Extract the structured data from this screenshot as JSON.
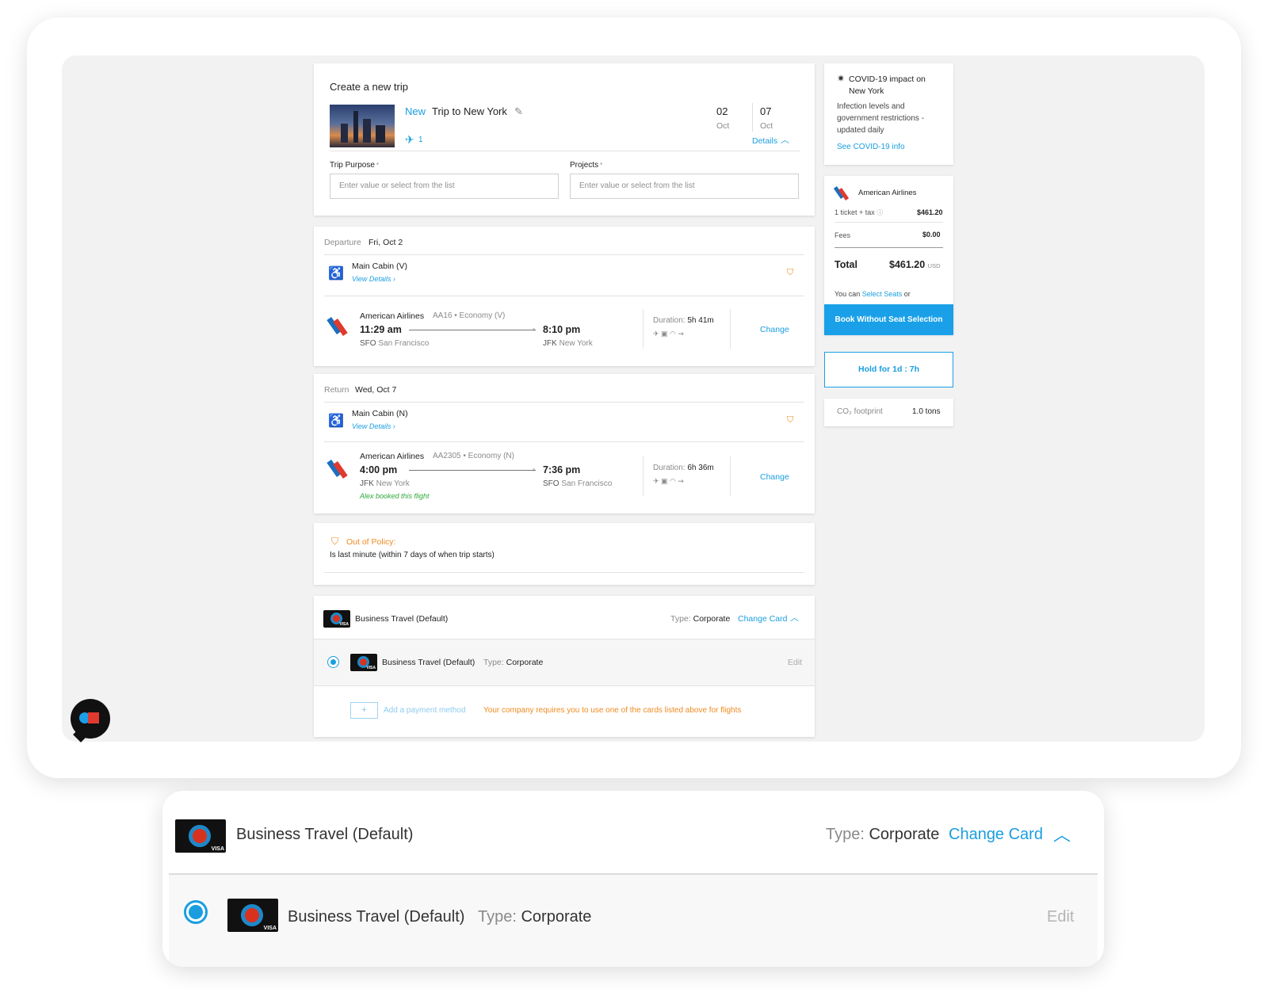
{
  "trip": {
    "heading": "Create a new trip",
    "new_badge": "New",
    "name": "Trip to New York",
    "travelers": "1",
    "start_day": "02",
    "start_month": "Oct",
    "end_day": "07",
    "end_month": "Oct",
    "details_link": "Details",
    "purpose_label": "Trip Purpose",
    "purpose_placeholder": "Enter value or select from the list",
    "projects_label": "Projects",
    "projects_placeholder": "Enter value or select from the list",
    "required_mark": "*"
  },
  "departure": {
    "label": "Departure",
    "date": "Fri, Oct 2",
    "cabin": "Main Cabin (V)",
    "view_details": "View Details ›",
    "airline": "American Airlines",
    "flight_info": "AA16 • Economy  (V)",
    "dep_time": "11:29 am",
    "arr_time": "8:10 pm",
    "dep_code": "SFO",
    "dep_city": "San Francisco",
    "arr_code": "JFK",
    "arr_city": "New York",
    "duration_label": "Duration:",
    "duration": "5h 41m",
    "change": "Change"
  },
  "return": {
    "label": "Return",
    "date": "Wed, Oct 7",
    "cabin": "Main Cabin (N)",
    "view_details": "View Details ›",
    "airline": "American Airlines",
    "flight_info": "AA2305 • Economy  (N)",
    "dep_time": "4:00 pm",
    "arr_time": "7:36 pm",
    "dep_code": "JFK",
    "dep_city": "New York",
    "arr_code": "SFO",
    "arr_city": "San Francisco",
    "booked_note": "Alex booked this flight",
    "duration_label": "Duration:",
    "duration": "6h 36m",
    "change": "Change"
  },
  "policy": {
    "title": "Out of Policy:",
    "reason": "Is last minute (within 7 days of when trip starts)"
  },
  "payment": {
    "card_name": "Business Travel (Default)",
    "type_label": "Type:",
    "type_value": "Corporate",
    "change_card": "Change Card",
    "edit": "Edit",
    "add_icon": "+",
    "add_method": "Add a payment method",
    "requirement": "Your company requires you to use one of the cards listed above for flights",
    "card_mark": "VISA"
  },
  "covid": {
    "title": "COVID-19 impact on New York",
    "body": "Infection levels and government restrictions - updated daily",
    "link": "See COVID-19 info"
  },
  "summary": {
    "airline": "American Airlines",
    "ticket_label": "1 ticket + tax",
    "ticket_value": "$461.20",
    "fees_label": "Fees",
    "fees_value": "$0.00",
    "total_label": "Total",
    "total_value": "$461.20",
    "currency": "USD",
    "seats_prefix": "You can",
    "seats_link": "Select Seats",
    "seats_suffix": "or",
    "book_button": "Book Without Seat Selection",
    "hold_button": "Hold for 1d : 7h",
    "co2_label": "CO₂ footprint",
    "co2_value": "1.0 tons"
  },
  "colors": {
    "accent_blue": "#1a9ee0",
    "policy_orange": "#f08a1f",
    "booked_green": "#2daa3a"
  }
}
